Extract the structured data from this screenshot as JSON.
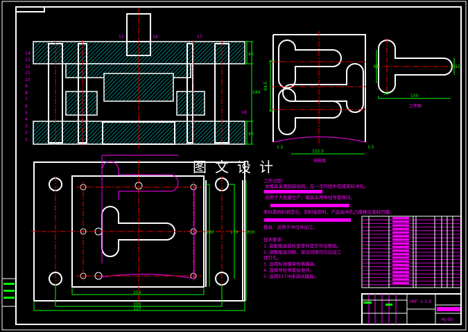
{
  "watermark": "图文设计",
  "section_view": {
    "part_labels": [
      "1",
      "2",
      "3",
      "4",
      "5",
      "6",
      "7",
      "8",
      "9",
      "10",
      "11",
      "12",
      "13",
      "14",
      "15",
      "16",
      "17",
      "18"
    ],
    "dimensions": {
      "upper": "40",
      "total": "184",
      "lower": "40"
    }
  },
  "strip_layout": {
    "caption": "排样图",
    "dimensions": {
      "pitch": "94.5",
      "width": "152.5",
      "gap_left": "1.2",
      "gap_right": "1.5"
    }
  },
  "part_drawing": {
    "caption": "工件图",
    "dimensions": {
      "height": "38",
      "length": "150",
      "head": "30",
      "end": "R15"
    }
  },
  "plan_view": {
    "dimensions": {
      "inner_width": "254",
      "outer_width": "300",
      "bolt_span": "320",
      "h1": "190",
      "h2": "170",
      "h3": "210"
    }
  },
  "notes": {
    "heading": "工作过程:",
    "paragraphs": [
      "本模具采用倒装结构，在一次行程中完成落料冲孔。",
      "适用于大批量生产，模具采用导柱导套导向。",
      "条料靠挡料销定位，卸料板卸料，产品由冲孔凸模推出落料凹模。",
      "模具：适用于冲压件加工。"
    ]
  },
  "tech_requirements": {
    "heading": "技术要求:",
    "items": [
      "1. 装配模具前检查零件是否符合图纸。",
      "2. 调整模具间隙，保证间隙均匀后加工",
      "   销钉孔。",
      "3. 选用标准模架规格模具。",
      "4. 选择导柱导套标准件。",
      "5. 选用EST冲床调试模具。"
    ]
  },
  "title_block": {
    "material": "08F",
    "scale": "1:1.0",
    "drawing_no": "MJ-00"
  },
  "colors": {
    "background": "#000000",
    "outline": "#ffffff",
    "center": "#ee0000",
    "dimension": "#00ff00",
    "annotation": "#ff00ff",
    "hatch": "#00cccc"
  }
}
